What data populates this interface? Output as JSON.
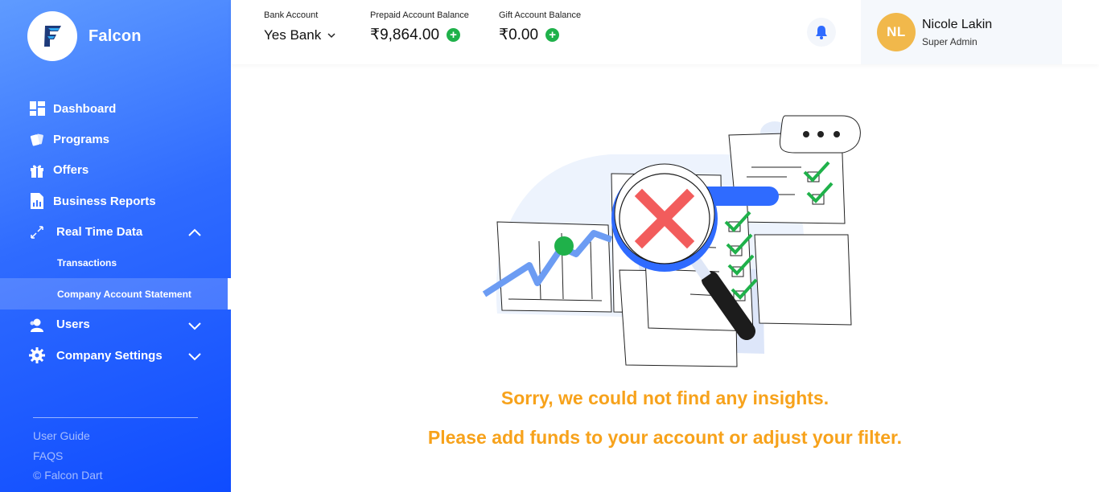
{
  "brand": {
    "name": "Falcon"
  },
  "sidebar": {
    "items": [
      {
        "label": "Dashboard",
        "icon": "dashboard-icon"
      },
      {
        "label": "Programs",
        "icon": "cards-icon"
      },
      {
        "label": "Offers",
        "icon": "gift-icon"
      },
      {
        "label": "Business Reports",
        "icon": "report-icon"
      },
      {
        "label": "Real Time Data",
        "icon": "realtime-arrows-icon",
        "expanded": true,
        "children": [
          {
            "label": "Transactions"
          },
          {
            "label": "Company Account Statement",
            "active": true
          }
        ]
      },
      {
        "label": "Users",
        "icon": "users-icon",
        "expanded": false
      },
      {
        "label": "Company Settings",
        "icon": "gear-icon",
        "expanded": false
      }
    ],
    "footer": {
      "user_guide": "User Guide",
      "faqs": "FAQS",
      "copyright": "© Falcon Dart"
    }
  },
  "header": {
    "bank_account": {
      "label": "Bank Account",
      "value": "Yes Bank"
    },
    "prepaid": {
      "label": "Prepaid Account Balance",
      "value": "₹9,864.00"
    },
    "gift": {
      "label": "Gift Account Balance",
      "value": "₹0.00"
    },
    "user": {
      "initials": "NL",
      "name": "Nicole Lakin",
      "role": "Super Admin"
    }
  },
  "main": {
    "empty_title": "Sorry, we could not find any insights.",
    "empty_subtitle": "Please add funds to your account or adjust your filter."
  },
  "colors": {
    "sidebar_gradient_start": "#5f9bff",
    "sidebar_gradient_end": "#0f4cff",
    "accent_orange": "#f7a21b",
    "plus_green": "#1fb14a",
    "avatar_bg": "#f1b84b",
    "bell_blue": "#2f6bff"
  }
}
